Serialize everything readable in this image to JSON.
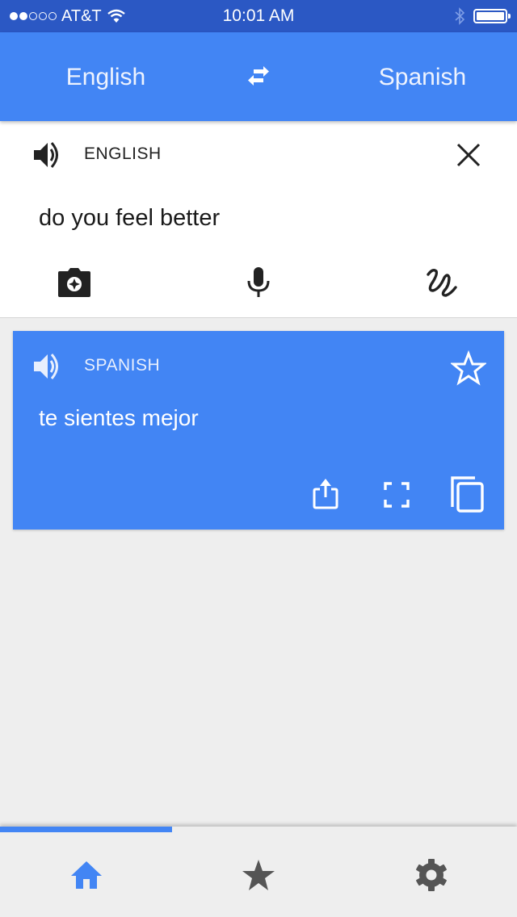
{
  "status_bar": {
    "signal_bars_filled": 2,
    "signal_bars_total": 5,
    "carrier": "AT&T",
    "time": "10:01 AM",
    "icons": [
      "wifi-icon",
      "bluetooth-icon",
      "battery-icon"
    ]
  },
  "language_bar": {
    "source_language": "English",
    "target_language": "Spanish",
    "swap_icon": "swap-arrows-icon"
  },
  "input_card": {
    "language_label": "ENGLISH",
    "text": "do you feel better",
    "icons": {
      "speak": "speaker-icon",
      "clear": "close-icon",
      "camera": "camera-icon",
      "voice": "microphone-icon",
      "handwriting": "handwriting-icon"
    }
  },
  "output_card": {
    "language_label": "SPANISH",
    "text": "te sientes mejor",
    "icons": {
      "speak": "speaker-icon",
      "favorite": "star-outline-icon",
      "share": "share-icon",
      "fullscreen": "fullscreen-icon",
      "copy": "copy-icon"
    }
  },
  "tab_bar": {
    "active_tab": "home",
    "tabs": [
      {
        "id": "home",
        "icon": "home-icon"
      },
      {
        "id": "phrasebook",
        "icon": "star-icon"
      },
      {
        "id": "settings",
        "icon": "gear-icon"
      }
    ]
  },
  "colors": {
    "accent": "#4285f4",
    "status_bar": "#2b58c4",
    "background": "#eeeeee",
    "icon_dark": "#555555"
  }
}
